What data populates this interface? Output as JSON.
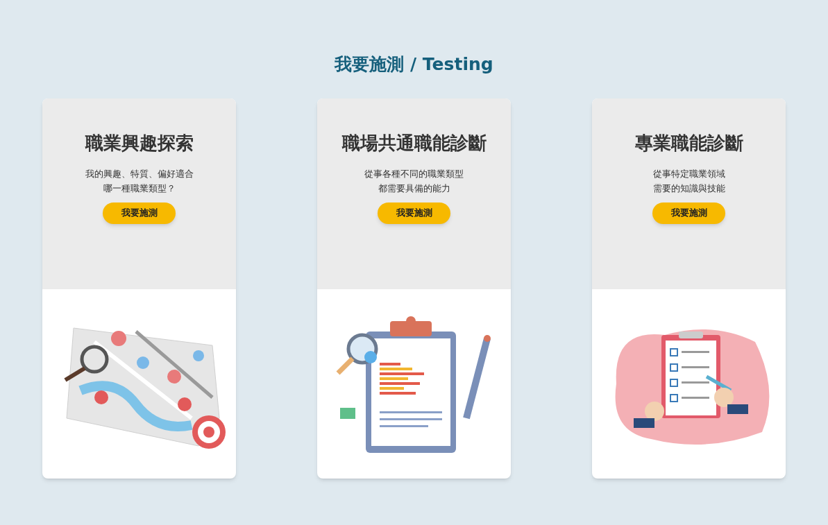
{
  "heading": "我要施測 / Testing",
  "cards": [
    {
      "kind": "map",
      "title": "職業興趣探索",
      "description": [
        "我的興趣、特質、偏好適合",
        "哪一種職業類型？"
      ],
      "button": "我要施測"
    },
    {
      "kind": "report",
      "title": "職場共通職能診斷",
      "description": [
        "從事各種不同的職業類型",
        "都需要具備的能力"
      ],
      "button": "我要施測"
    },
    {
      "kind": "checklist",
      "title": "專業職能診斷",
      "description": [
        "從事特定職業領域",
        "需要的知識與技能"
      ],
      "button": "我要施測"
    }
  ]
}
